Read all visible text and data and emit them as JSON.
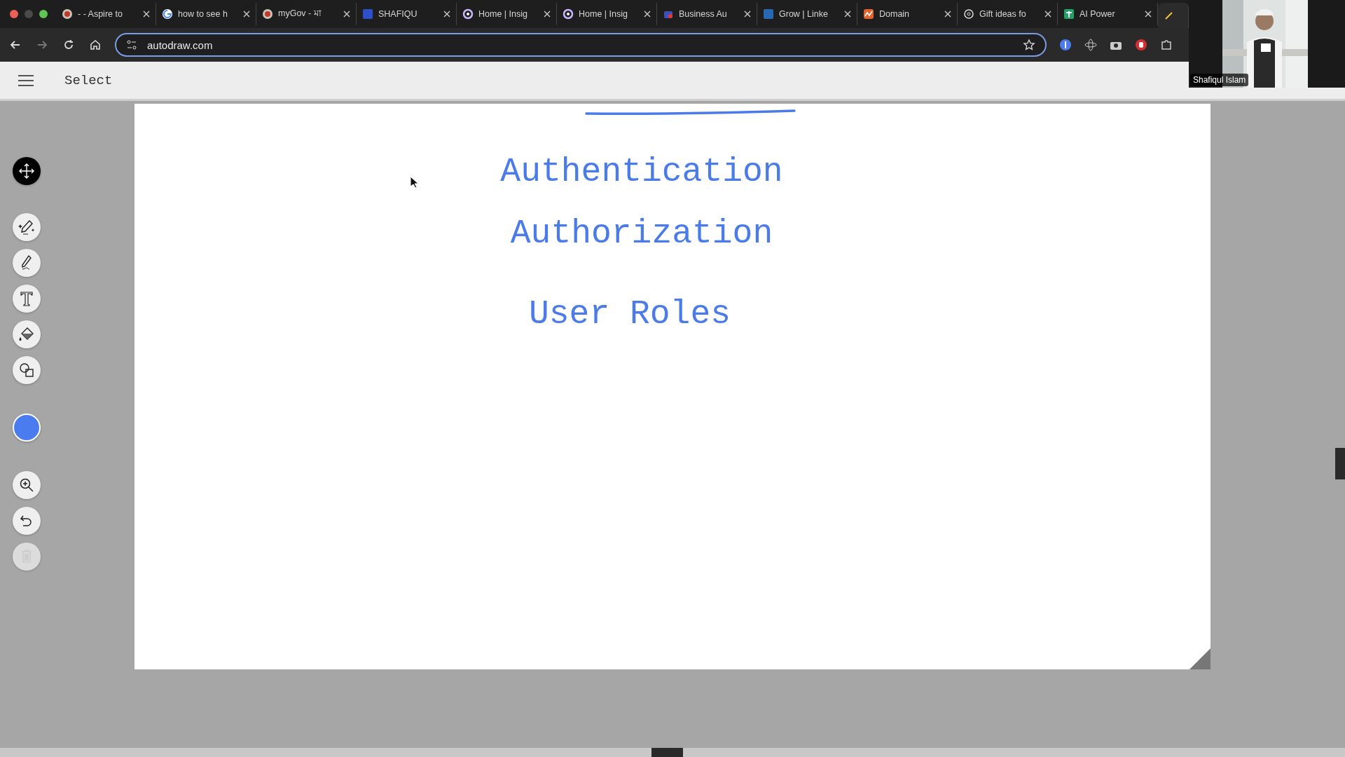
{
  "browser": {
    "tabs": [
      {
        "title": "- - Aspire to",
        "selected": false
      },
      {
        "title": "how to see h",
        "selected": false
      },
      {
        "title": "myGov - মা",
        "selected": false
      },
      {
        "title": "SHAFIQU",
        "selected": false
      },
      {
        "title": "Home | Insig",
        "selected": false
      },
      {
        "title": "Home | Insig",
        "selected": false
      },
      {
        "title": "Business Au",
        "selected": false
      },
      {
        "title": "Grow | Linke",
        "selected": false
      },
      {
        "title": "Domain",
        "selected": false
      },
      {
        "title": "Gift ideas fo",
        "selected": false
      },
      {
        "title": "AI Power",
        "selected": false
      },
      {
        "selected": true
      }
    ],
    "url": "autodraw.com"
  },
  "app": {
    "mode": "Select"
  },
  "tools": [
    {
      "kind": "move",
      "selected": true
    },
    {
      "kind": "autodraw",
      "selected": false
    },
    {
      "kind": "draw",
      "selected": false
    },
    {
      "kind": "text",
      "selected": false
    },
    {
      "kind": "fill",
      "selected": false
    },
    {
      "kind": "shape",
      "selected": false
    },
    {
      "kind": "color",
      "color": "#4a7cf0",
      "selected": false
    },
    {
      "kind": "zoom",
      "selected": false
    },
    {
      "kind": "undo",
      "selected": false
    },
    {
      "kind": "delete",
      "disabled": true,
      "selected": false
    }
  ],
  "canvas": {
    "texts": [
      "Authentication",
      "Authorization",
      "User Roles"
    ]
  },
  "webcam": {
    "name": "Shafiqul Islam"
  }
}
